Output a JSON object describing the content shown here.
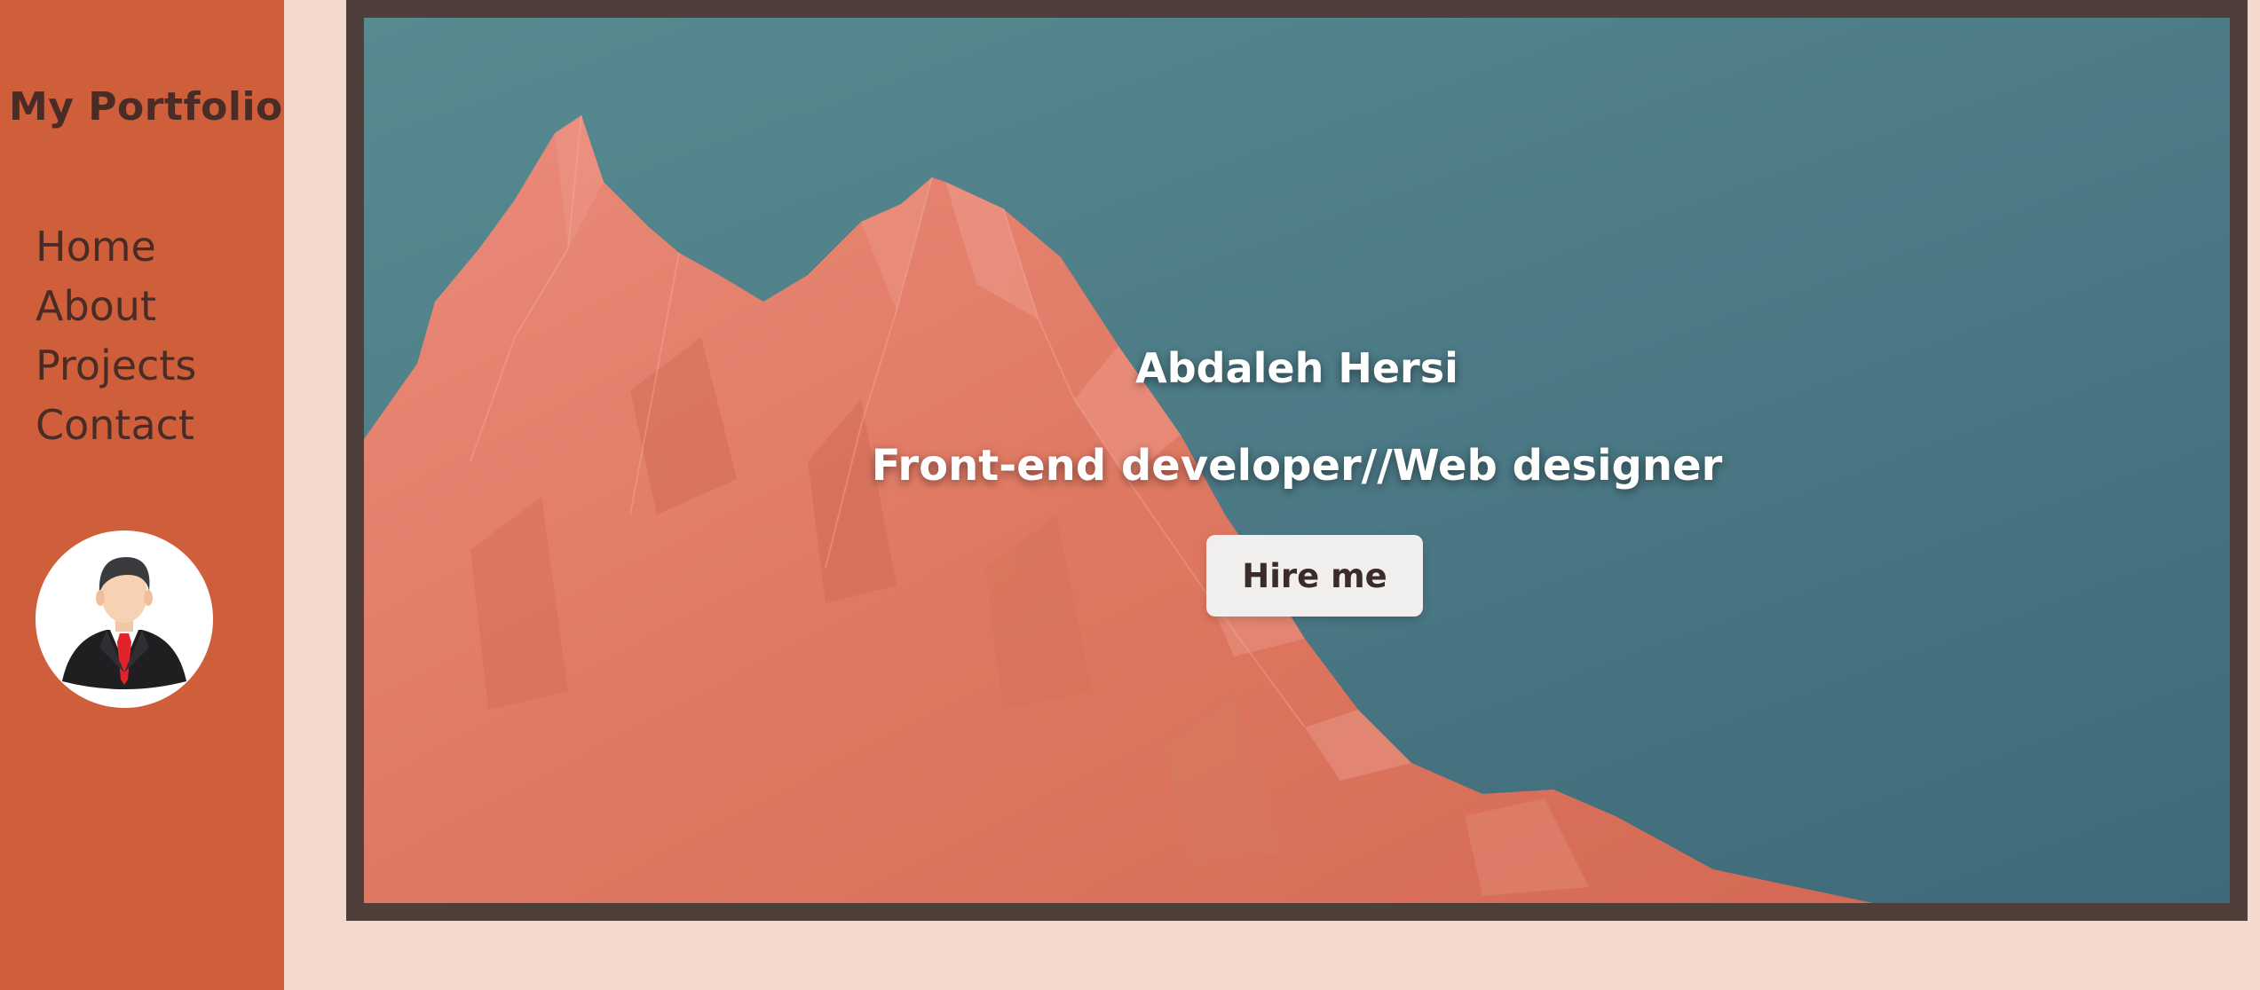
{
  "sidebar": {
    "brand": "My Portfolio",
    "nav": [
      {
        "label": "Home"
      },
      {
        "label": "About"
      },
      {
        "label": "Projects"
      },
      {
        "label": "Contact"
      }
    ],
    "avatar_icon": "businessman-avatar-icon"
  },
  "hero": {
    "name": "Abdaleh Hersi",
    "role": "Front-end developer//Web designer",
    "cta_label": "Hire me"
  },
  "colors": {
    "sidebar_bg": "#cf5f3a",
    "page_bg": "#f4d9ce",
    "frame": "#4f3f3a",
    "sky": "#4d7b86",
    "mountain": "#e07a66",
    "text_dark": "#4a2c27",
    "button_bg": "#f1efee"
  }
}
